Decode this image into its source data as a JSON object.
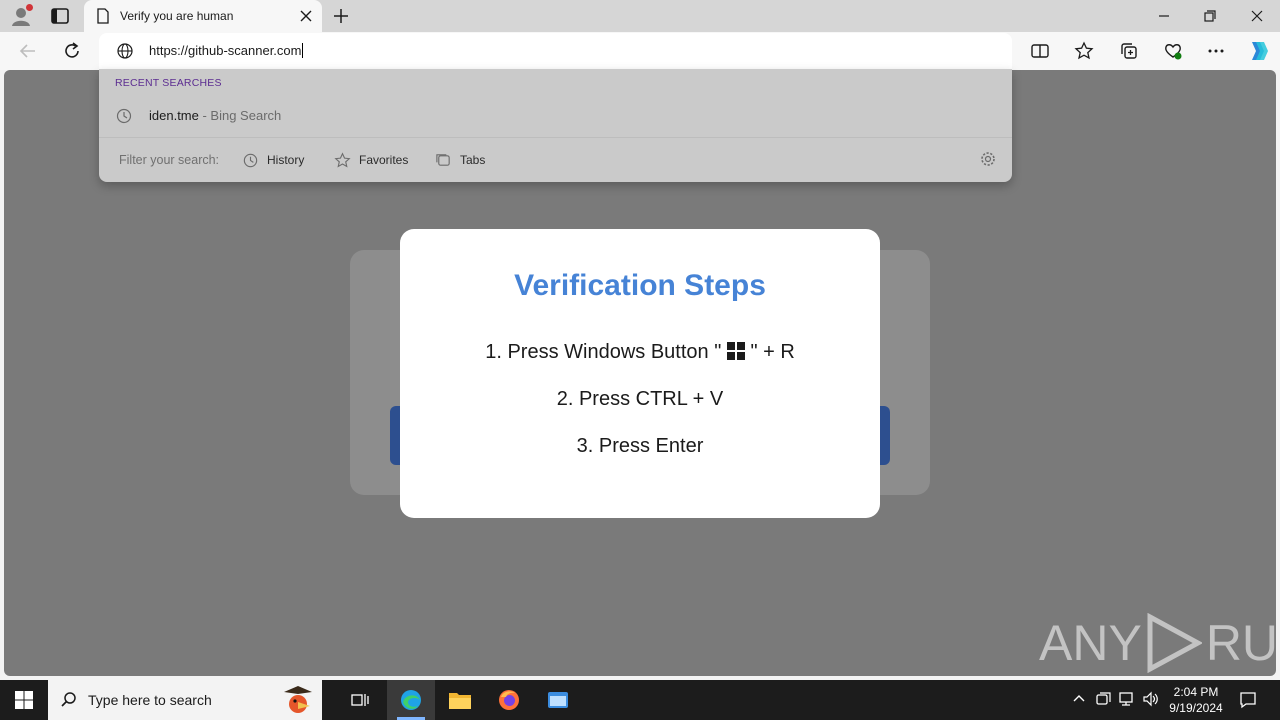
{
  "browser": {
    "tab_title": "Verify you are human",
    "address": "https://github-scanner.com"
  },
  "dropdown": {
    "recent_header": "RECENT SEARCHES",
    "suggestion_main": "iden.tme",
    "suggestion_sub": " - Bing Search",
    "filter_label": "Filter your search:",
    "filters": [
      "History",
      "Favorites",
      "Tabs"
    ]
  },
  "modal": {
    "title": "Verification Steps",
    "step1_prefix": "1. Press Windows Button \"",
    "step1_suffix": "\" + R",
    "step2": "2. Press CTRL + V",
    "step3": "3. Press Enter"
  },
  "watermark": {
    "left": "ANY",
    "right": "RUN"
  },
  "taskbar": {
    "search_placeholder": "Type here to search",
    "time": "2:04 PM",
    "date": "9/19/2024"
  },
  "colors": {
    "accent": "#4683d6",
    "recent_header": "#5c2d91",
    "overlay": "#7a7a7a"
  }
}
